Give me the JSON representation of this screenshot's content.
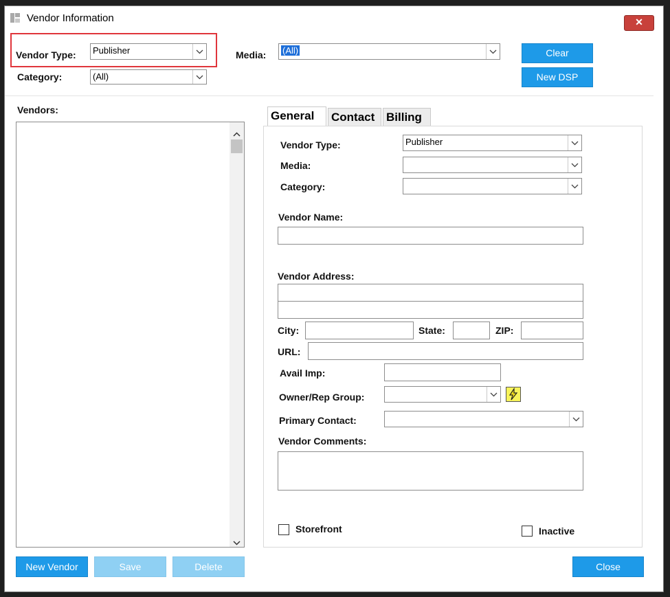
{
  "window": {
    "title": "Vendor Information",
    "close_glyph": "✕"
  },
  "filters": {
    "vendor_type_label": "Vendor Type:",
    "vendor_type_value": "Publisher",
    "media_label": "Media:",
    "media_value": "(All)",
    "category_label": "Category:",
    "category_value": "(All)"
  },
  "buttons": {
    "clear": "Clear",
    "new_dsp": "New DSP",
    "new_vendor": "New Vendor",
    "save": "Save",
    "delete": "Delete",
    "close": "Close"
  },
  "vendors": {
    "label": "Vendors:",
    "items": []
  },
  "tabs": [
    {
      "label": "General",
      "active": true
    },
    {
      "label": "Contact",
      "active": false
    },
    {
      "label": "Billing",
      "active": false
    }
  ],
  "general": {
    "vendor_type_label": "Vendor Type:",
    "vendor_type_value": "Publisher",
    "media_label": "Media:",
    "media_value": "",
    "category_label": "Category:",
    "category_value": "",
    "vendor_name_label": "Vendor Name:",
    "vendor_name_value": "",
    "vendor_address_label": "Vendor Address:",
    "address_line1": "",
    "address_line2": "",
    "city_label": "City:",
    "state_label": "State:",
    "zip_label": "ZIP:",
    "url_label": "URL:",
    "avail_imp_label": "Avail Imp:",
    "owner_rep_group_label": "Owner/Rep Group:",
    "primary_contact_label": "Primary Contact:",
    "vendor_comments_label": "Vendor Comments:",
    "storefront_label": "Storefront",
    "inactive_label": "Inactive"
  },
  "colors": {
    "accent": "#1e9ae8",
    "highlight": "#e0353b",
    "close": "#c8413b"
  },
  "icons": [
    "app-icon",
    "close-icon",
    "chevron-down-icon",
    "lightning-icon",
    "scroll-up-icon",
    "scroll-down-icon"
  ]
}
